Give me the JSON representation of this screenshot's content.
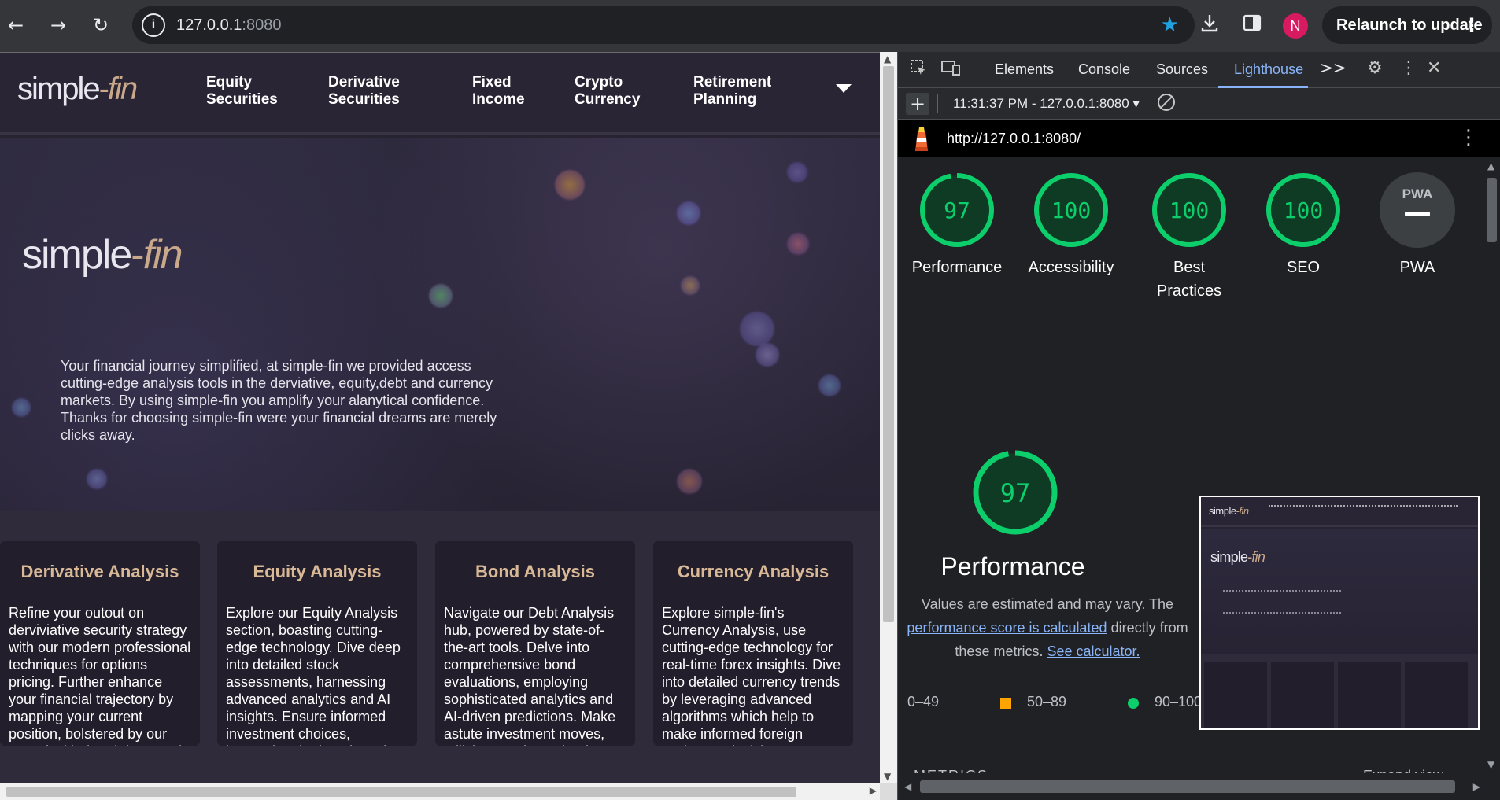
{
  "browser": {
    "url_host": "127.0.0.1",
    "url_port": ":8080",
    "relaunch_label": "Relaunch to update",
    "profile_initial": "N",
    "icons": {
      "back": "arrow-left-icon",
      "forward": "arrow-right-icon",
      "reload": "reload-icon",
      "site_info": "info-icon",
      "bookmark": "star-icon",
      "download": "download-icon",
      "side_panel": "side-panel-icon",
      "menu": "kebab-menu-icon"
    }
  },
  "site": {
    "logo_main": "simple",
    "logo_dash": "-",
    "logo_accent": "fin",
    "nav": [
      {
        "line1": "Equity",
        "line2": "Securities"
      },
      {
        "line1": "Derivative",
        "line2": "Securities"
      },
      {
        "line1": "Fixed",
        "line2": "Income"
      },
      {
        "line1": "Crypto",
        "line2": "Currency"
      },
      {
        "line1": "Retirement",
        "line2": "Planning"
      }
    ],
    "hero_text": "Your financial journey simplified, at simple-fin we provided access cutting-edge analysis tools in the derviative, equity,debt and currency markets. By using simple-fin you amplify your alanytical confidence. Thanks for choosing simple-fin were your financial dreams are merely clicks away.",
    "cards": [
      {
        "title": "Derivative Analysis",
        "text": "Refine your outout on derviviative security strategy with our modern professional techniques for options pricing. Further enhance your financial trajectory by mapping your current position, bolstered by our one of a kind real-time stock analytics"
      },
      {
        "title": "Equity Analysis",
        "text": "Explore our Equity Analysis section, boasting cutting-edge technology. Dive deep into detailed stock assessments, harnessing advanced analytics and AI insights. Ensure informed investment choices, leveraging the best in tech to decode market nuances"
      },
      {
        "title": "Bond Analysis",
        "text": "Navigate our Debt Analysis hub, powered by state-of-the-art tools. Delve into comprehensive bond evaluations, employing sophisticated analytics and AI-driven predictions. Make astute investment moves, utilizing top-tier technology to unravel debt market"
      },
      {
        "title": "Currency Analysis",
        "text": "Explore simple-fin's Currency Analysis, use cutting-edge technology for real-time forex insights. Dive into detailed currency trends by leveraging advanced algorithms which help to make informed foreign exchange decisions. Your gateway to the next-gen"
      }
    ]
  },
  "devtools": {
    "tabs": [
      "Elements",
      "Console",
      "Sources",
      "Lighthouse"
    ],
    "active_tab": "Lighthouse",
    "more_tabs": ">>",
    "report_label": "11:31:37 PM - 127.0.0.1:8080",
    "report_caret": "▾",
    "add_label": "+",
    "audited_url": "http://127.0.0.1:8080/",
    "scores": [
      {
        "label": "Performance",
        "score": "97",
        "value": 97
      },
      {
        "label": "Accessibility",
        "score": "100",
        "value": 100
      },
      {
        "label": "Best Practices",
        "score": "100",
        "value": 100
      },
      {
        "label": "SEO",
        "score": "100",
        "value": 100
      },
      {
        "label": "PWA",
        "score": "—",
        "badge": "PWA"
      }
    ],
    "perf_score": "97",
    "perf_title": "Performance",
    "perf_desc_prefix": "Values are estimated and may vary. The",
    "perf_desc_link": "performance score is calculated",
    "perf_desc_mid": "directly from these metrics.",
    "perf_desc_calc": "See calculator.",
    "legend": [
      "0–49",
      "50–89",
      "90–100"
    ],
    "metrics_label": "METRICS",
    "expand_label": "Expand view",
    "colors": {
      "pass": "#0cce6b",
      "average": "#ffa400",
      "fail": "#ff4e42",
      "accent": "#8ab4f8"
    }
  }
}
